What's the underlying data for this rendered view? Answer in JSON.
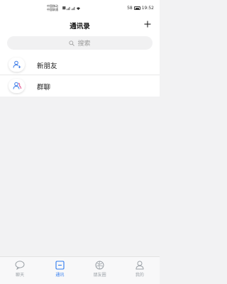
{
  "status_bar": {
    "carrier_line1": "中国移动",
    "carrier_line2": "中国联通",
    "time": "19:52",
    "battery_text": "58"
  },
  "header": {
    "title": "通讯录",
    "add_icon": "plus-icon"
  },
  "search": {
    "placeholder": "搜索",
    "icon": "search-icon"
  },
  "contacts": [
    {
      "label": "新朋友",
      "icon": "add-user-icon"
    },
    {
      "label": "群聊",
      "icon": "group-icon"
    }
  ],
  "tabbar": {
    "accent_color": "#2f7bf0",
    "inactive_color": "#9aa0a6",
    "tabs": [
      {
        "label": "聊天",
        "icon": "chat-bubble-icon",
        "active": false
      },
      {
        "label": "通讯",
        "icon": "contacts-book-icon",
        "active": true
      },
      {
        "label": "朋友圈",
        "icon": "moments-icon",
        "active": false
      },
      {
        "label": "我的",
        "icon": "profile-icon",
        "active": false
      }
    ]
  }
}
